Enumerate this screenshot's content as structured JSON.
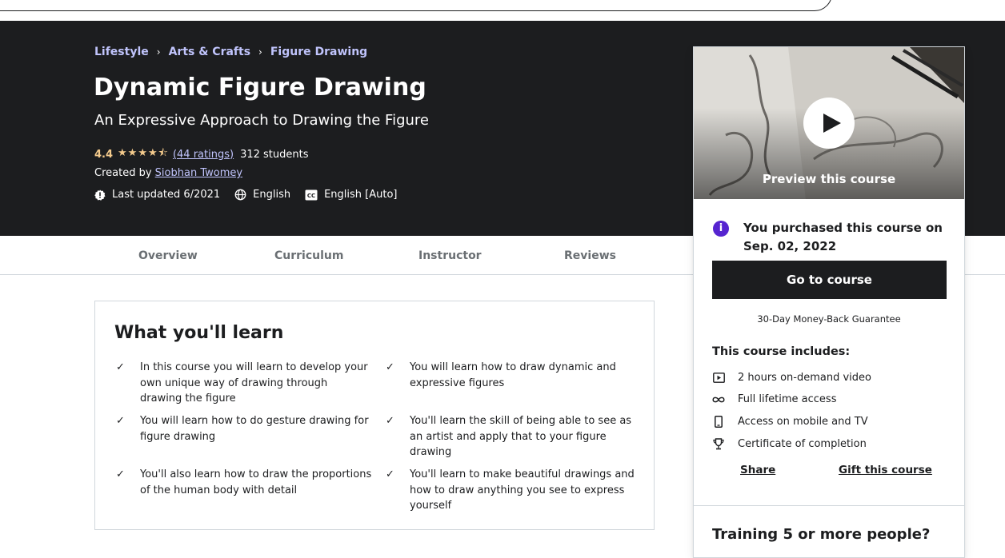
{
  "breadcrumb": {
    "items": [
      "Lifestyle",
      "Arts & Crafts",
      "Figure Drawing"
    ],
    "separator": "›"
  },
  "course": {
    "title": "Dynamic Figure Drawing",
    "subtitle": "An Expressive Approach to Drawing the Figure",
    "rating": "4.4",
    "stars": "★★★★⯪",
    "ratings_link": "(44 ratings)",
    "students": "312 students",
    "created_by_label": "Created by",
    "author": "Siobhan Twomey",
    "last_updated": "Last updated 6/2021",
    "language": "English",
    "captions": "English [Auto]"
  },
  "tabs": [
    "Overview",
    "Curriculum",
    "Instructor",
    "Reviews"
  ],
  "learn": {
    "title": "What you'll learn",
    "check_glyph": "✓",
    "items": [
      "In this course you will learn to develop your own unique way of drawing through drawing the figure",
      "You will learn how to draw dynamic and expressive figures",
      "You will learn how to do gesture drawing for figure drawing",
      "You'll learn the skill of being able to see as an artist and apply that to your figure drawing",
      "You'll also learn how to draw the proportions of the human body with detail",
      "You'll learn to make beautiful drawings and how to draw anything you see to express yourself"
    ]
  },
  "sidebar": {
    "preview_label": "Preview this course",
    "purchased_text": "You purchased this course on Sep. 02, 2022",
    "info_glyph": "i",
    "go_button": "Go to course",
    "guarantee": "30-Day Money-Back Guarantee",
    "includes_title": "This course includes:",
    "includes": [
      {
        "icon": "video-icon",
        "label": "2 hours on-demand video"
      },
      {
        "icon": "infinity-icon",
        "label": "Full lifetime access"
      },
      {
        "icon": "mobile-icon",
        "label": "Access on mobile and TV"
      },
      {
        "icon": "trophy-icon",
        "label": "Certificate of completion"
      }
    ],
    "share": "Share",
    "gift": "Gift this course",
    "training": "Training 5 or more people?"
  },
  "colors": {
    "hero_bg": "#1c1d1f",
    "link_purple": "#c0c4fc",
    "star_gold": "#f3ca8c",
    "info_purple": "#5624d0"
  }
}
